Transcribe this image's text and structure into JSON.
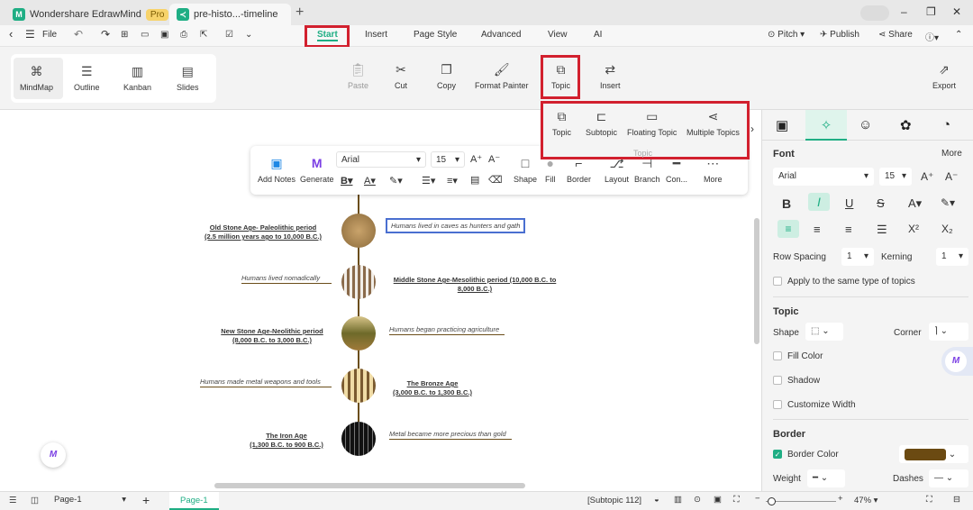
{
  "titlebar": {
    "app_name": "Wondershare EdrawMind",
    "pro_badge": "Pro",
    "doc_tab": "pre-histo...-timeline",
    "close": "×",
    "new_tab": "+",
    "minimize": "–",
    "restore": "❐",
    "close_window": "✕"
  },
  "menubar": {
    "file": "File",
    "tabs": [
      "Start",
      "Insert",
      "Page Style",
      "Advanced",
      "View",
      "AI"
    ],
    "pitch": "Pitch",
    "publish": "Publish",
    "share": "Share"
  },
  "ribbon": {
    "views": [
      "MindMap",
      "Outline",
      "Kanban",
      "Slides"
    ],
    "paste": "Paste",
    "cut": "Cut",
    "copy": "Copy",
    "format_painter": "Format Painter",
    "topic": "Topic",
    "insert": "Insert",
    "export": "Export"
  },
  "topic_dropdown": {
    "items": [
      "Topic",
      "Subtopic",
      "Floating Topic",
      "Multiple Topics"
    ],
    "group_label": "Topic"
  },
  "floating_toolbar": {
    "add_notes": "Add Notes",
    "generate": "Generate",
    "font": "Arial",
    "size": "15",
    "shape": "Shape",
    "fill": "Fill",
    "border": "Border",
    "layout": "Layout",
    "branch": "Branch",
    "connector": "Con...",
    "more": "More"
  },
  "timeline": {
    "periods": [
      {
        "title": "Old Stone Age- Paleolithic period",
        "dates": "(2.5 million years ago to 10,000 B.C.)",
        "note": "Humans lived in caves as hunters and gath"
      },
      {
        "title": "Middle Stone Age-Mesolithic period (10,000 B.C. to",
        "dates": "8,000 B.C.)",
        "note": "Humans lived nomadically"
      },
      {
        "title": "New Stone Age-Neolithic period",
        "dates": "(8,000 B.C. to 3,000 B.C.)",
        "note": "Humans began practicing agriculture"
      },
      {
        "title": "The Bronze Age",
        "dates": "(3,000 B.C. to 1,300 B.C.)",
        "note": "Humans made metal weapons and tools"
      },
      {
        "title": "The Iron Age",
        "dates": "(1,300 B.C. to 900 B.C.)",
        "note": "Metal became more precious than gold"
      }
    ]
  },
  "panel": {
    "font_heading": "Font",
    "more": "More",
    "font": "Arial",
    "size": "15",
    "row_spacing": "Row Spacing",
    "row_spacing_val": "1",
    "kerning": "Kerning",
    "kerning_val": "1",
    "apply_same": "Apply to the same type of topics",
    "topic_heading": "Topic",
    "shape": "Shape",
    "corner": "Corner",
    "fill_color": "Fill Color",
    "shadow": "Shadow",
    "customize_width": "Customize Width",
    "border_heading": "Border",
    "border_color": "Border Color",
    "border_color_value": "#6b4a12",
    "weight": "Weight",
    "dashes": "Dashes"
  },
  "status": {
    "page_select": "Page-1",
    "page_tab": "Page-1",
    "selection": "[Subtopic 112]",
    "zoom": "47%"
  },
  "colors": {
    "accent": "#1fae84",
    "highlight": "#d2202e",
    "branch": "#6b4e1a"
  }
}
